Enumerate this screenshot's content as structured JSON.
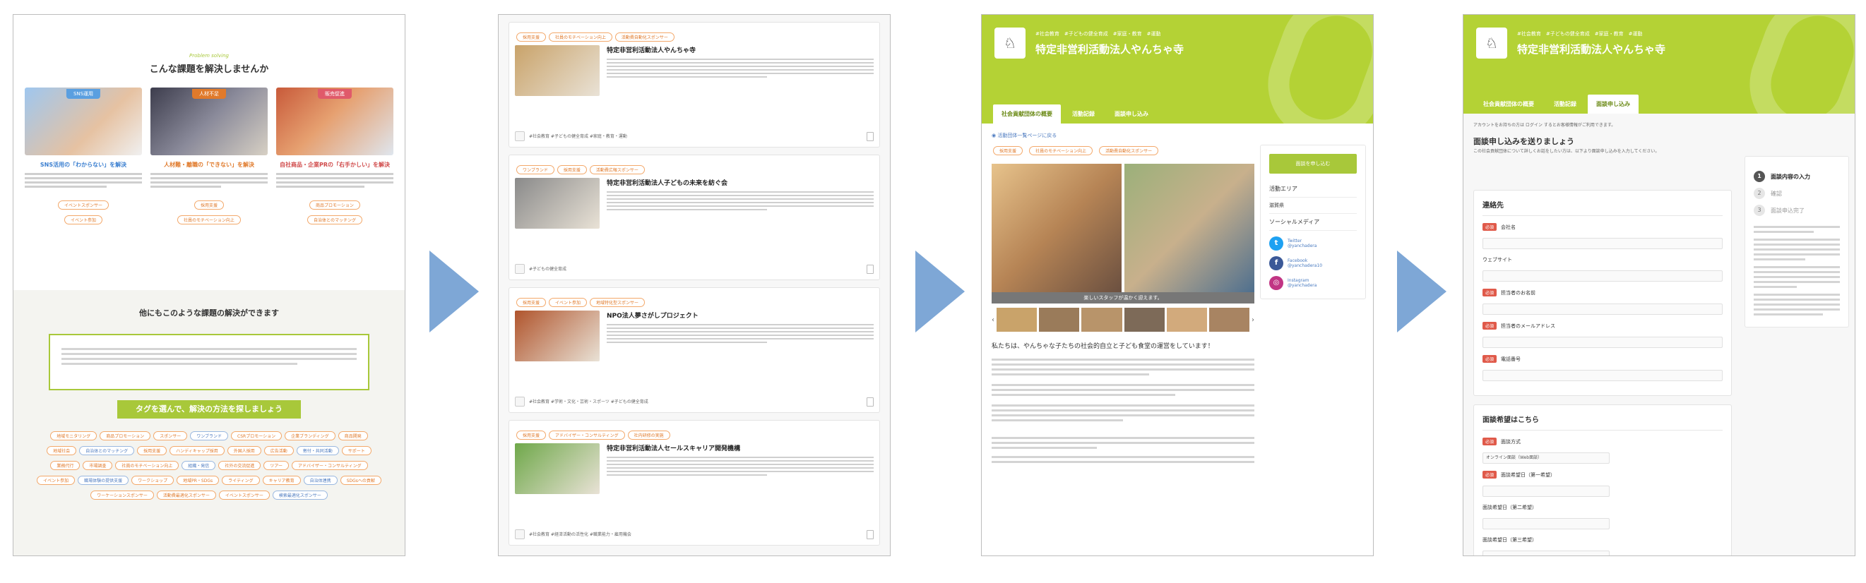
{
  "colors": {
    "brand_green": "#b4d235",
    "accent_orange": "#e07a2b",
    "arrow_blue": "#7ea7d6"
  },
  "panel1": {
    "eyebrow": "Problem solving",
    "title": "こんな課題を解決しませんか",
    "columns": [
      {
        "tag": "SNS運用",
        "tag_color": "#5a9fe0",
        "title": "SNS活用の「わからない」を解決",
        "title_color": "#3b7fd0",
        "pills": [
          "イベントスポンサー",
          "イベント参加"
        ]
      },
      {
        "tag": "人材不足",
        "tag_color": "#e07a2b",
        "title": "人材難・離職の「できない」を解決",
        "title_color": "#e07a2b",
        "pills": [
          "採用支援",
          "社員のモチベーション向上"
        ]
      },
      {
        "tag": "販売促進",
        "tag_color": "#e05a6a",
        "title": "自社商品・企業PRの「右手かしい」を解決",
        "title_color": "#d04a4a",
        "pills": [
          "商品プロモーション",
          "自治体とのマッチング"
        ]
      }
    ],
    "mid_title": "他にもこのような課題の解決ができます",
    "green_bar": "タグを選んで、解決の方法を探しましょう",
    "tag_cloud": [
      "地域モニタリング",
      "商品プロモーション",
      "スポンサー",
      "ワンブランド",
      "CSRプロモーション",
      "企業ブランディング",
      "商品開発",
      "地域社会",
      "自治体とのマッチング",
      "採用支援",
      "ハンディキャップ採用",
      "外国人採用",
      "広告活動",
      "寄付・共同活動",
      "サポート",
      "業務代行",
      "市場調査",
      "社員のモチベーション向上",
      "組織・発信",
      "社外の交流促進",
      "ツアー",
      "アドバイザー・コンサルティング",
      "イベント参加",
      "職場体験の提供支援",
      "ワークショップ",
      "地域PR・SDGs",
      "ライティング",
      "キャリア教育",
      "自治体連携",
      "SDGsへの貢献",
      "ワーケーションスポンサー",
      "活動費最適化スポンサー",
      "イベントスポンサー",
      "検索最適化スポンサー"
    ]
  },
  "panel2": {
    "cards": [
      {
        "tags": [
          "採用支援",
          "社員のモチベーション向上",
          "活動費自動化スポンサー"
        ],
        "title": "特定非営利活動法人やんちゃ寺",
        "footer": "#社会教育 #子どもの健全育成 #家庭・教育・運動",
        "img": "#c9a36a"
      },
      {
        "tags": [
          "ワンブランド",
          "採用支援",
          "活動費広報スポンサー"
        ],
        "title": "特定非営利活動法人子どもの未来を紡ぐ会",
        "footer": "#子どもの健全育成",
        "img": "#8a8a8a"
      },
      {
        "tags": [
          "採用支援",
          "イベント参加",
          "地域特化型スポンサー"
        ],
        "title": "NPO法人夢さがしプロジェクト",
        "footer": "#社会教育 #学術・文化・芸術・スポーツ #子どもの健全育成",
        "img": "#b0542c"
      },
      {
        "tags": [
          "採用支援",
          "アドバイザー・コンサルティング",
          "社内研修の実施"
        ],
        "title": "特定非営利活動法人セールスキャリア開発機構",
        "footer": "#社会教育 #経済活動の活性化 #職業能力・雇用機会",
        "img": "#6fa84a"
      }
    ]
  },
  "panel3": {
    "meta": "#社会教育　#子どもの健全育成　#家庭・教育　#運動",
    "org_name": "特定非営利活動法人やんちゃ寺",
    "tabs": [
      "社会貢献団体の概要",
      "活動記録",
      "面談申し込み"
    ],
    "back_link": "活動団体一覧ページに戻る",
    "tags": [
      "採用支援",
      "社員のモチベーション向上",
      "活動費自動化スポンサー"
    ],
    "photo_caption": "楽しいスタッフが温かく迎えます。",
    "sidebar": {
      "button": "面談を申し込む",
      "area": "活動エリア",
      "area_value": "滋賀県",
      "social": "ソーシャルメディア",
      "links": [
        {
          "name": "Twitter",
          "handle": "@yanchadera",
          "color": "#1da1f2",
          "glyph": "t"
        },
        {
          "name": "Facebook",
          "handle": "@yanchadera10",
          "color": "#3b5998",
          "glyph": "f"
        },
        {
          "name": "Instagram",
          "handle": "@yanchadera",
          "color": "#c13584",
          "glyph": "◎"
        }
      ]
    },
    "intro": "私たちは、やんちゃな子たちの社会的自立と子ども食堂の運営をしています！"
  },
  "panel4": {
    "meta": "#社会教育　#子どもの健全育成　#家庭・教育　#運動",
    "org_name": "特定非営利活動法人やんちゃ寺",
    "tabs": [
      "社会貢献団体の概要",
      "活動記録",
      "面談申し込み"
    ],
    "notice": "アカウントをお持ちの方は ログイン するとお客様情報がご利用できます。",
    "form_title": "面談申し込みを送りましょう",
    "form_sub": "この社会貢献団体について詳しくお話をしたい方は、以下より面談申し込みを入力してください。",
    "company": {
      "heading": "連絡先",
      "req": "必須",
      "fields": [
        "会社名",
        "ウェブサイト",
        "担当者のお名前",
        "担当者のメールアドレス",
        "電話番号"
      ],
      "required": [
        true,
        false,
        true,
        true,
        true
      ]
    },
    "schedule": {
      "heading": "面談希望はこちら",
      "fields": [
        "面談方式",
        "面談希望日（第一希望）",
        "面談希望日（第二希望）",
        "面談希望日（第三希望）"
      ],
      "select_value": "オンライン面談（Web面談）"
    },
    "steps": [
      "面談内容の入力",
      "確認",
      "面談申込完了"
    ]
  }
}
